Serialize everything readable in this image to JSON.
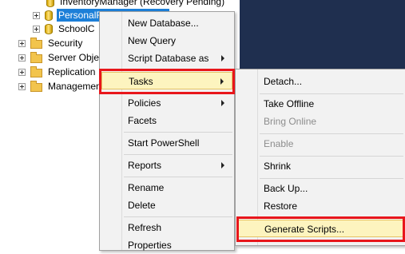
{
  "tree": {
    "items": [
      {
        "label": "InventoryManager (Recovery Pending)",
        "icon": "database-icon"
      },
      {
        "label": "PersonalFinanceManager",
        "icon": "database-icon",
        "selected": true
      },
      {
        "label": "SchoolC",
        "icon": "database-icon"
      },
      {
        "label": "Security",
        "icon": "folder-icon"
      },
      {
        "label": "Server Objects",
        "icon": "folder-icon"
      },
      {
        "label": "Replication",
        "icon": "folder-icon"
      },
      {
        "label": "Management",
        "icon": "folder-icon"
      }
    ]
  },
  "context_menu": {
    "items": {
      "new_database": "New Database...",
      "new_query": "New Query",
      "script_database_as": "Script Database as",
      "tasks": "Tasks",
      "policies": "Policies",
      "facets": "Facets",
      "start_powershell": "Start PowerShell",
      "reports": "Reports",
      "rename": "Rename",
      "delete": "Delete",
      "refresh": "Refresh",
      "properties": "Properties"
    }
  },
  "tasks_submenu": {
    "items": {
      "detach": "Detach...",
      "take_offline": "Take Offline",
      "bring_online": "Bring Online",
      "enable": "Enable",
      "shrink": "Shrink",
      "back_up": "Back Up...",
      "restore": "Restore",
      "generate_scripts": "Generate Scripts..."
    }
  },
  "colors": {
    "selection": "#1c7fd8",
    "menu_highlight": "#fdf4bf",
    "callout": "#e8161b"
  }
}
